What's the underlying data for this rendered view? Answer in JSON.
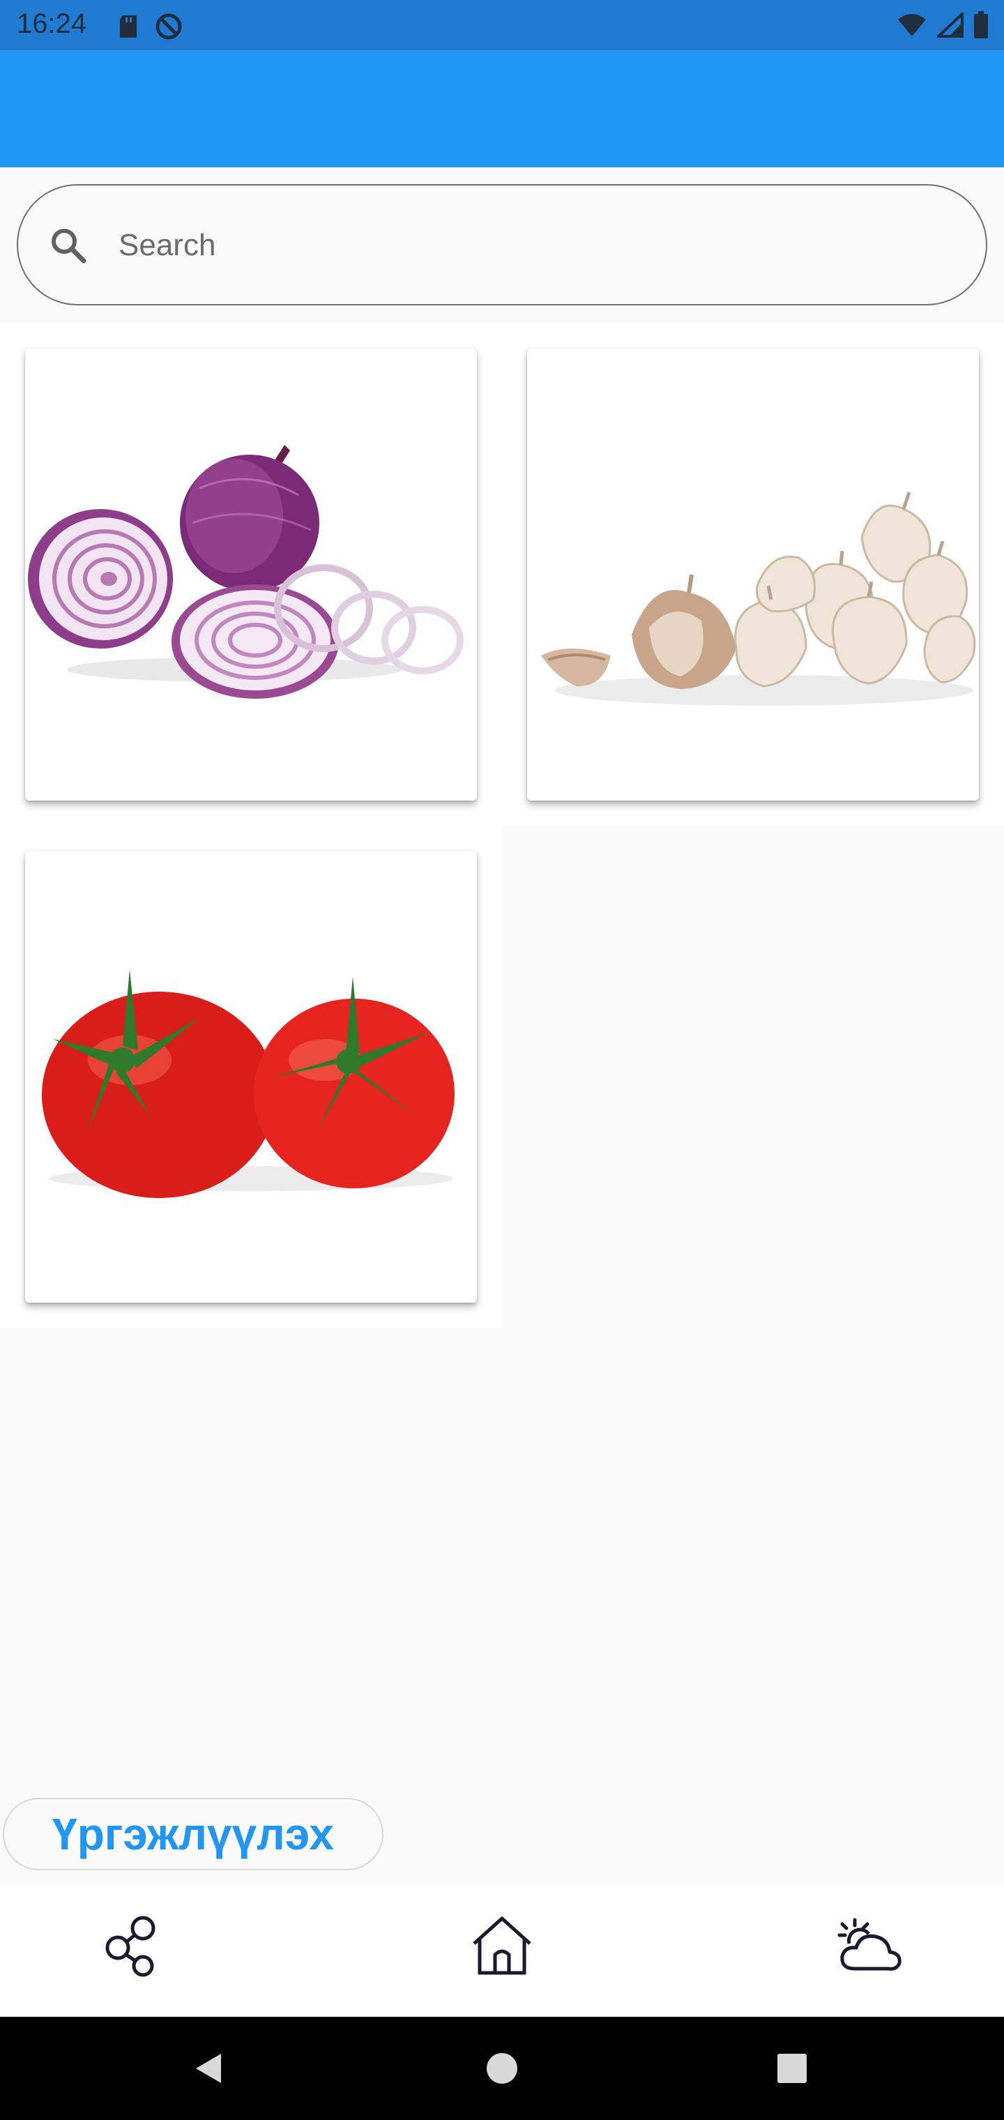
{
  "status_bar": {
    "time": "16:24",
    "icons_left": [
      "sd-card-icon",
      "do-not-disturb-icon"
    ],
    "icons_right": [
      "wifi-icon",
      "signal-icon",
      "battery-icon"
    ]
  },
  "app_bar": {
    "title": ""
  },
  "search": {
    "placeholder": "Search",
    "value": ""
  },
  "grid": {
    "items": [
      {
        "name": "onion-image"
      },
      {
        "name": "garlic-image"
      },
      {
        "name": "tomato-image"
      }
    ]
  },
  "continue_button": {
    "label": "Үргэжлүүлэх"
  },
  "bottom_nav": {
    "items": [
      "share-icon",
      "home-icon",
      "weather-icon"
    ]
  },
  "system_nav": {
    "items": [
      "back-icon",
      "home-circle-icon",
      "recents-icon"
    ]
  },
  "colors": {
    "app_bar": "#2196f3",
    "status_bar": "#1f7bd2",
    "accent_text": "#2196f3"
  }
}
